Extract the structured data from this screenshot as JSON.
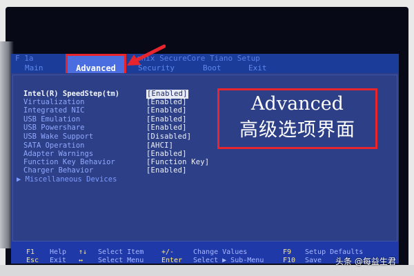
{
  "bios": {
    "title": "Phoenix SecureCore Tiano Setup",
    "title_prefix_left": "F 1a",
    "title_right": "enix SecureCore Tiano Setup",
    "menu": [
      {
        "label": "Main"
      },
      {
        "label": "Advanced",
        "active": true
      },
      {
        "label": "Security"
      },
      {
        "label": "Boot"
      },
      {
        "label": "Exit"
      }
    ],
    "settings": [
      {
        "label": "Intel(R) SpeedStep(tm)",
        "value": "[Enabled]"
      },
      {
        "label": "Virtualization",
        "value": "[Enabled]"
      },
      {
        "label": "Integrated NIC",
        "value": "[Enabled]"
      },
      {
        "label": "USB Emulation",
        "value": "[Enabled]"
      },
      {
        "label": "USB Powershare",
        "value": "[Enabled]"
      },
      {
        "label": "USB Wake Support",
        "value": "[Disabled]"
      },
      {
        "label": "SATA Operation",
        "value": "[AHCI]"
      },
      {
        "label": "Adapter Warnings",
        "value": "[Enabled]"
      },
      {
        "label": "Function Key Behavior",
        "value": "[Function Key]"
      },
      {
        "label": "Charger Behavior",
        "value": "[Enabled]"
      },
      {
        "label": "▶ Miscellaneous Devices",
        "value": ""
      }
    ],
    "footer": {
      "row1": [
        {
          "key": "F1",
          "desc": "Help"
        },
        {
          "key": "↑↓",
          "desc": "Select Item"
        },
        {
          "key": "+/-",
          "desc": "Change Values"
        },
        {
          "key": "F9",
          "desc": "Setup Defaults"
        }
      ],
      "row2": [
        {
          "key": "Esc",
          "desc": "Exit"
        },
        {
          "key": "↔",
          "desc": "Select Menu"
        },
        {
          "key": "Enter",
          "desc": "Select ▶ Sub-Menu"
        },
        {
          "key": "F10",
          "desc": "Save"
        }
      ]
    }
  },
  "annotation": {
    "line1": "Advanced",
    "line2": "高级选项界面"
  },
  "watermark": "头条 @每益生君",
  "colors": {
    "screen_bg": "#2d3f86",
    "highlight_red": "#e8242c",
    "active_tab": "#4a6ee0",
    "footer_bg": "#1f3aa8",
    "label_blue": "#8fa8ff",
    "value_white": "#eef2ff",
    "key_yellow": "#ffe97a"
  }
}
